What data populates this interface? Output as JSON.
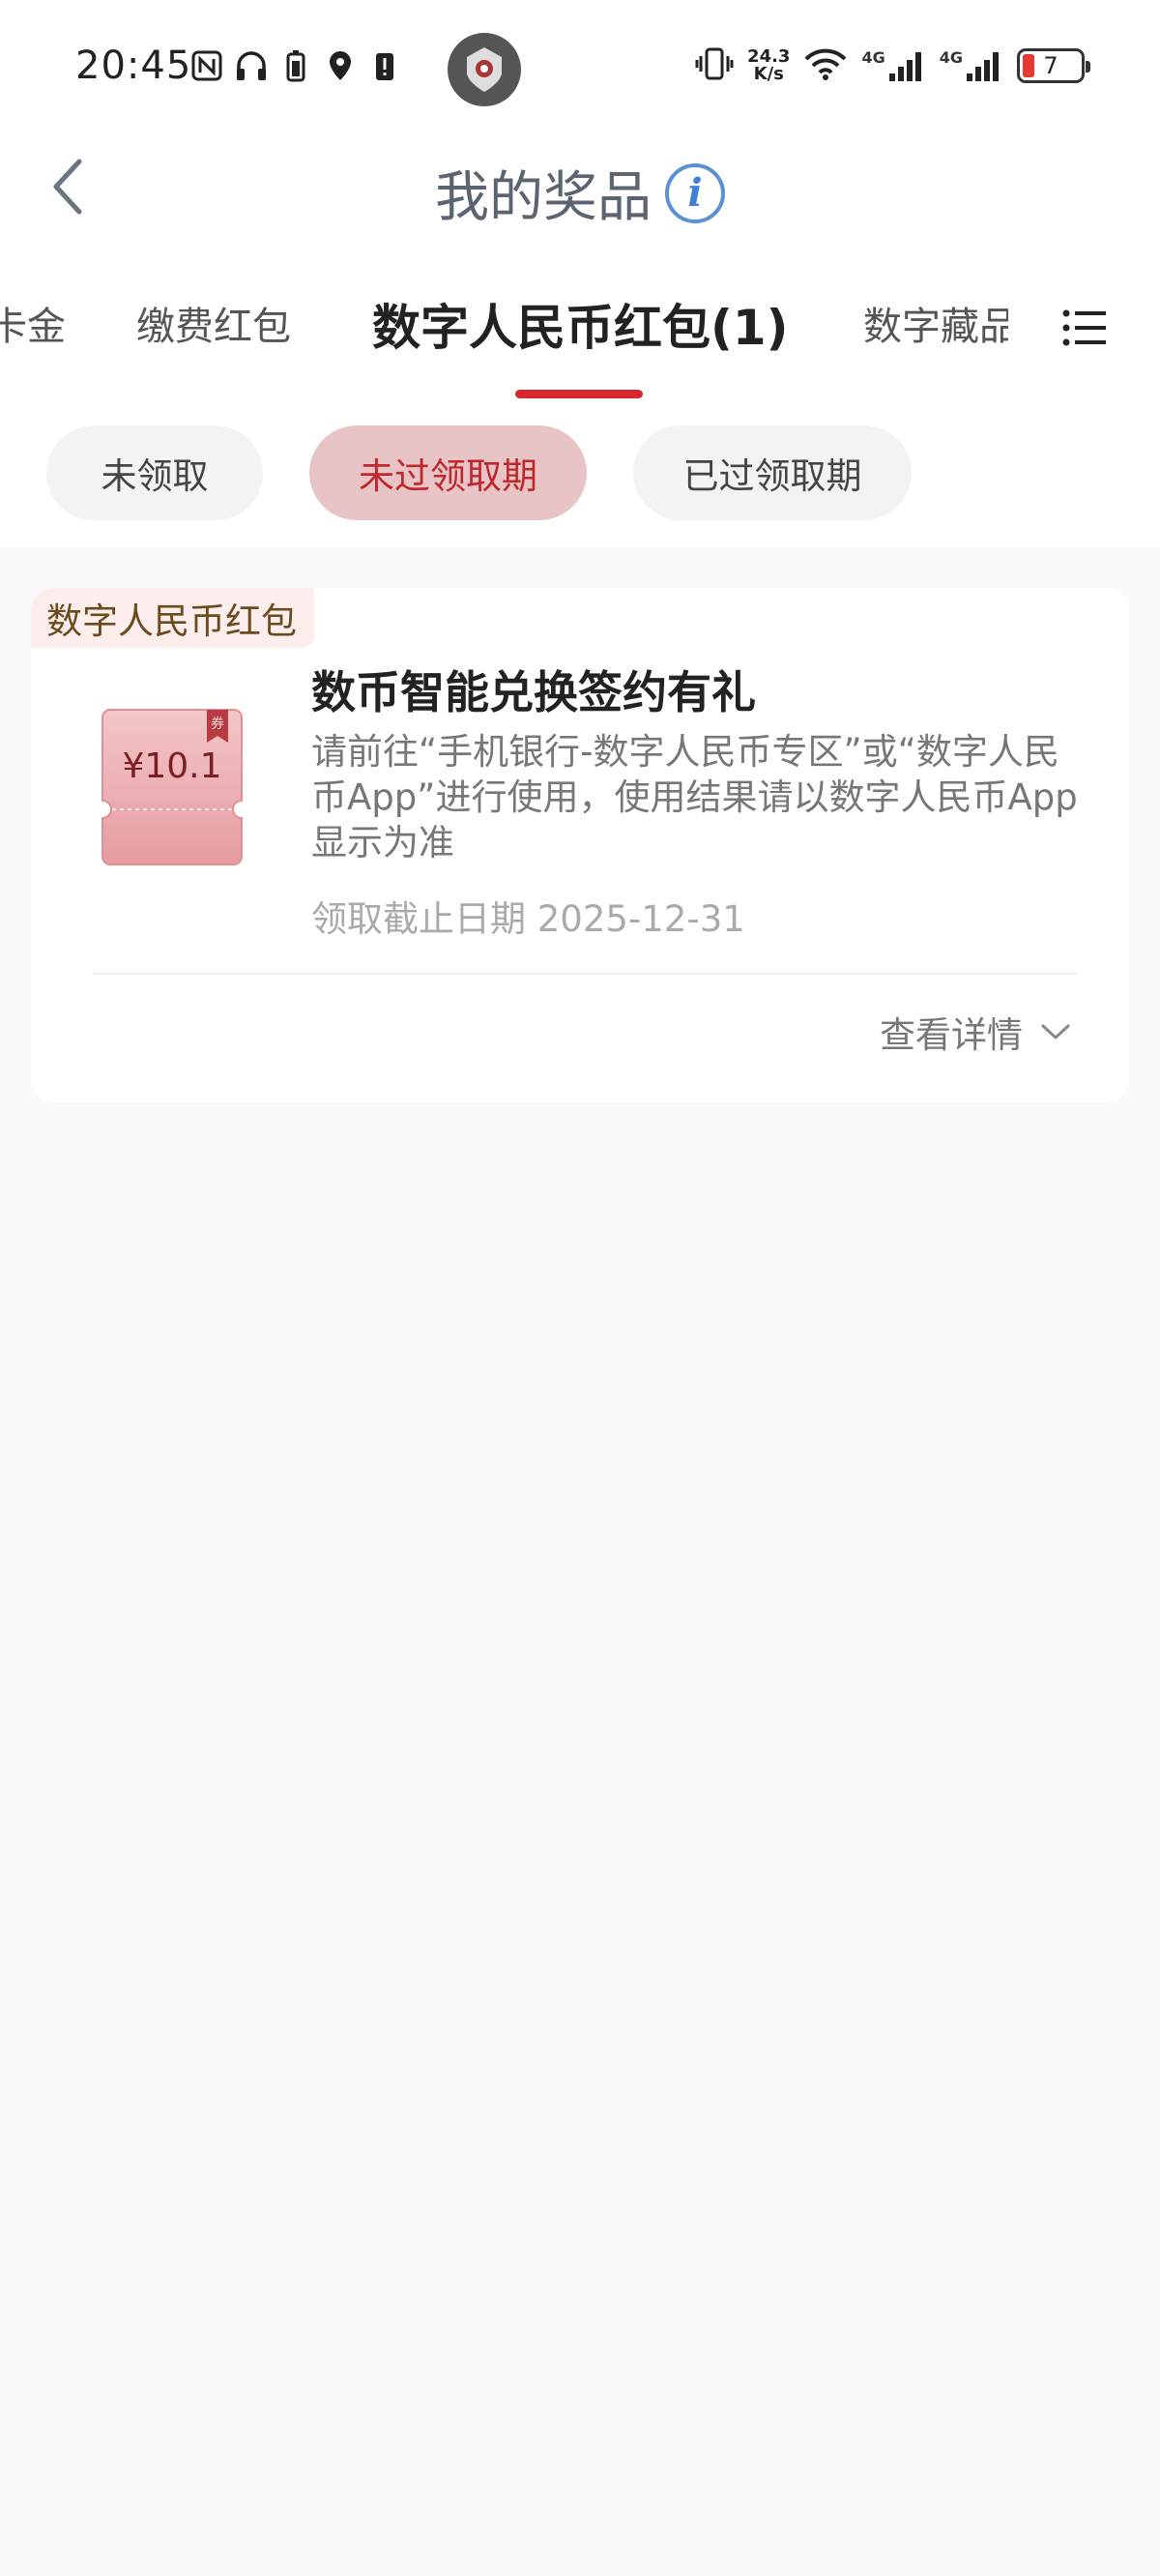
{
  "status_bar": {
    "time": "20:45",
    "net_speed_value": "24.3",
    "net_speed_unit": "K/s",
    "signal_label_1": "4G",
    "signal_label_2": "4G",
    "battery_level": "7"
  },
  "header": {
    "title": "我的奖品",
    "info_glyph": "i"
  },
  "tabs": [
    {
      "label": "卡金"
    },
    {
      "label": "缴费红包"
    },
    {
      "label": "数字人民币红包(1)",
      "active": true
    },
    {
      "label": "数字藏品"
    }
  ],
  "filters": [
    {
      "label": "未领取"
    },
    {
      "label": "未过领取期",
      "active": true
    },
    {
      "label": "已过领取期"
    }
  ],
  "prize_card": {
    "tag": "数字人民币红包",
    "coupon_amount": "¥10.1",
    "coupon_badge": "券",
    "title": "数币智能兑换签约有礼",
    "description": "请前往“手机银行-数字人民币专区”或“数字人民币App”进行使用，使用结果请以数字人民币App显示为准",
    "deadline": "领取截止日期 2025-12-31",
    "details_label": "查看详情"
  },
  "colors": {
    "accent_red": "#d8272f",
    "active_chip_bg": "#e8c4c6",
    "tag_bg": "#fdeeee"
  }
}
